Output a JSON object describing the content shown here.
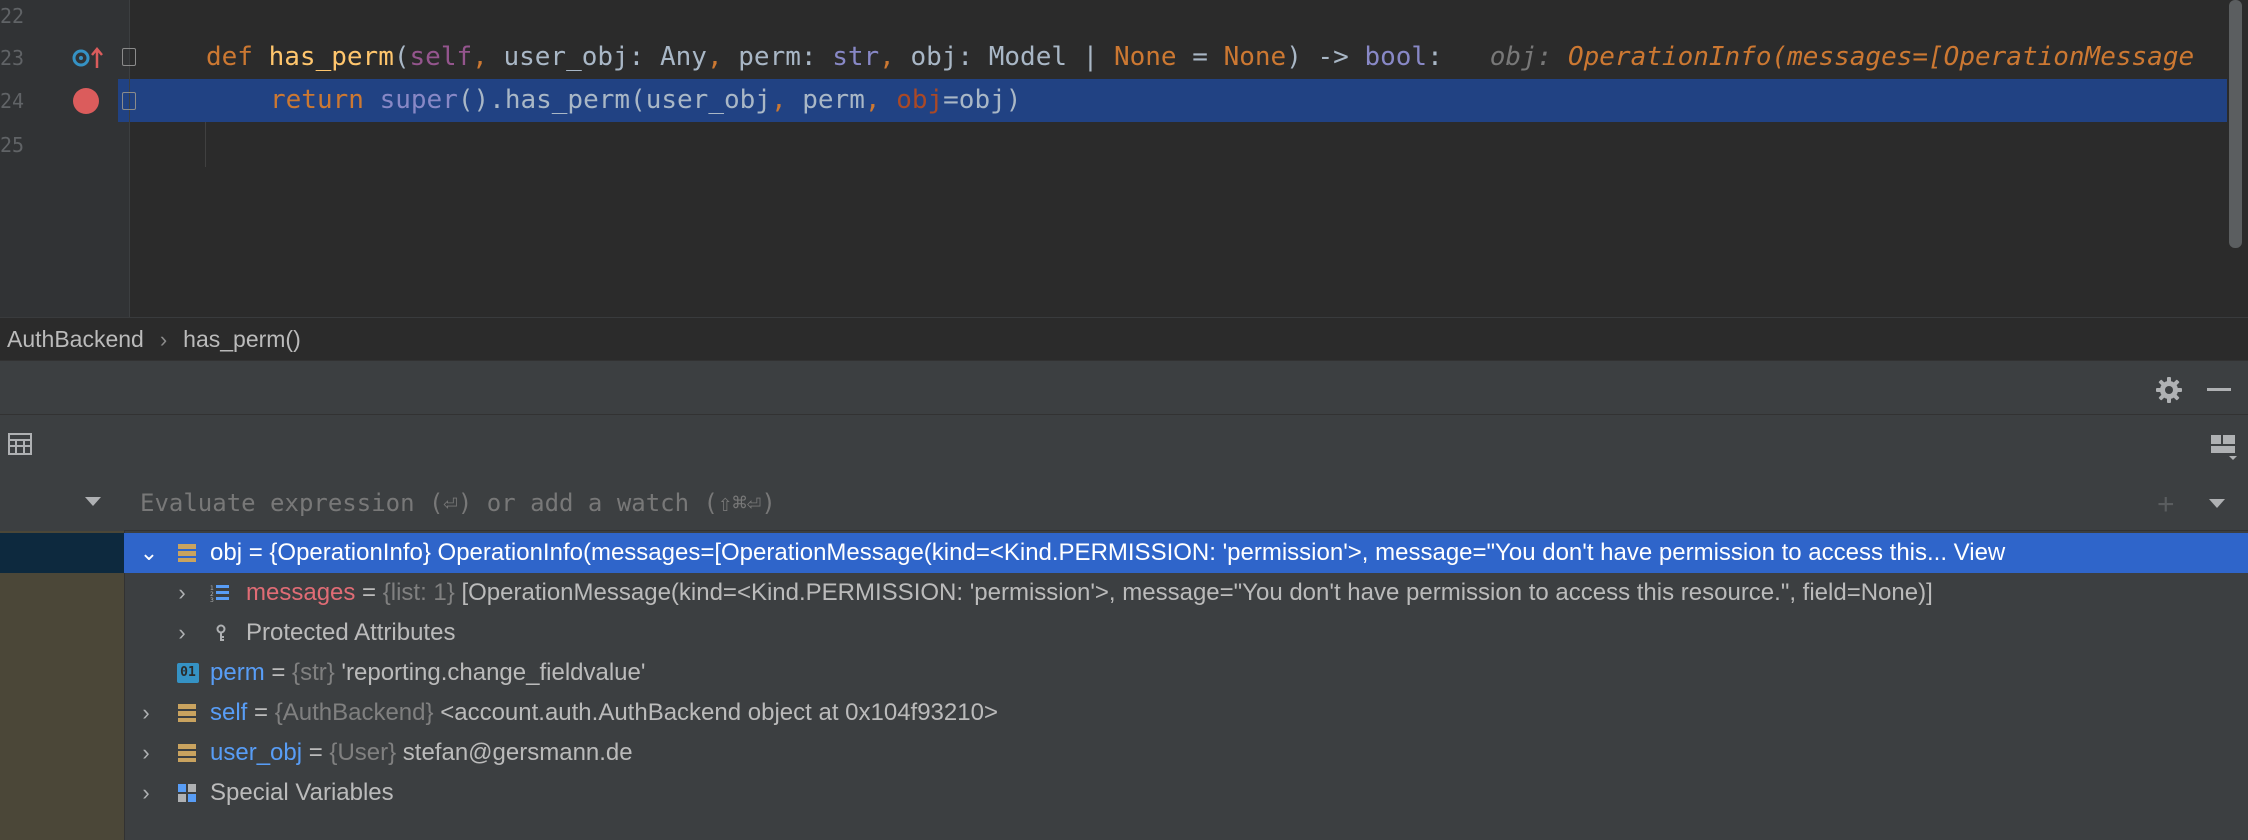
{
  "editor": {
    "line_numbers": [
      "22",
      "23",
      "24",
      "25"
    ],
    "line23": {
      "kw_def": "def",
      "fn_name": "has_perm",
      "paren_open": "(",
      "self": "self",
      "comma1": ", ",
      "user_obj": "user_obj: Any",
      "comma2": ", ",
      "perm": "perm: ",
      "str": "str",
      "comma3": ", ",
      "obj": "obj: Model | ",
      "none1": "None",
      "eq": " = ",
      "none2": "None",
      "ret": ") -> ",
      "bool": "bool",
      "colon": ":",
      "hint_label": "obj: ",
      "hint_value": "OperationInfo(messages=[OperationMessage"
    },
    "line24": {
      "kw_return": "return",
      "super": "super",
      "call": "().has_perm(user_obj",
      "comma1": ", ",
      "perm": "perm",
      "comma2": ", ",
      "obj_param": "obj",
      "rest": "=obj)"
    }
  },
  "breadcrumb": {
    "class_name": "AuthBackend",
    "separator": "›",
    "method_name": "has_perm()"
  },
  "debugger": {
    "eval_placeholder": "Evaluate expression (⏎) or add a watch (⇧⌘⏎)",
    "add_watch_glyph": "+",
    "variables": [
      {
        "name": "obj",
        "eq": " = ",
        "type": "{OperationInfo}",
        "value": " OperationInfo(messages=[OperationMessage(kind=<Kind.PERMISSION: 'permission'>, message=\"You don't have permission to access this... ",
        "link": "View"
      },
      {
        "name": "messages",
        "eq": " = ",
        "type": "{list: 1}",
        "value": " [OperationMessage(kind=<Kind.PERMISSION: 'permission'>, message=\"You don't have permission to access this resource.\", field=None)]"
      },
      {
        "label": "Protected Attributes"
      },
      {
        "name": "perm",
        "eq": " = ",
        "type": "{str}",
        "value": " 'reporting.change_fieldvalue'"
      },
      {
        "name": "self",
        "eq": " = ",
        "type": "{AuthBackend}",
        "value": " <account.auth.AuthBackend object at 0x104f93210>"
      },
      {
        "name": "user_obj",
        "eq": " = ",
        "type": "{User}",
        "value": " stefan@gersmann.de"
      },
      {
        "label": "Special Variables"
      }
    ],
    "str_icon_text": "01"
  },
  "colors": {
    "selection": "#2f65ca",
    "line_highlight": "#214283",
    "breakpoint": "#db5c5c"
  }
}
